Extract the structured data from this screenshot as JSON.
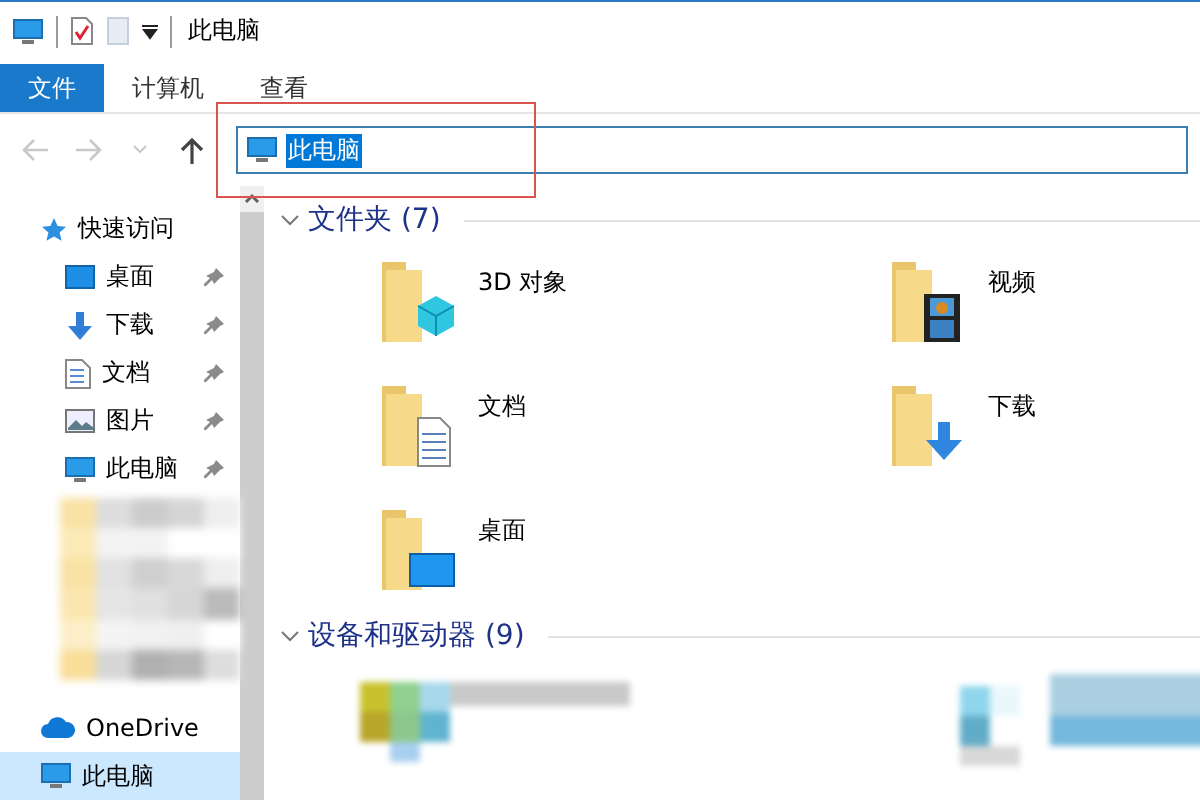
{
  "window": {
    "title": "此电脑"
  },
  "ribbon_tabs": [
    {
      "label": "文件",
      "selected": true
    },
    {
      "label": "计算机",
      "selected": false
    },
    {
      "label": "查看",
      "selected": false
    }
  ],
  "address": {
    "value": "此电脑",
    "selected": true
  },
  "sidebar": {
    "items": [
      {
        "label": "快速访问",
        "kind": "quick",
        "selected": false,
        "children": [
          {
            "label": "桌面",
            "kind": "desktop",
            "pinned": true,
            "selected": false
          },
          {
            "label": "下载",
            "kind": "download",
            "pinned": true,
            "selected": false
          },
          {
            "label": "文档",
            "kind": "documents",
            "pinned": true,
            "selected": false
          },
          {
            "label": "图片",
            "kind": "pictures",
            "pinned": true,
            "selected": false
          },
          {
            "label": "此电脑",
            "kind": "pc",
            "pinned": true,
            "selected": false
          }
        ]
      },
      {
        "label": "OneDrive",
        "kind": "cloud",
        "selected": false
      },
      {
        "label": "此电脑",
        "kind": "pc",
        "selected": true
      }
    ]
  },
  "sections": [
    {
      "title": "文件夹 (7)",
      "expanded": true,
      "items": [
        {
          "name": "3D 对象",
          "kind": "cube"
        },
        {
          "name": "视频",
          "kind": "video"
        },
        {
          "name": "文档",
          "kind": "documents"
        },
        {
          "name": "下载",
          "kind": "download"
        },
        {
          "name": "桌面",
          "kind": "desktop"
        }
      ]
    },
    {
      "title": "设备和驱动器 (9)",
      "expanded": true
    }
  ]
}
